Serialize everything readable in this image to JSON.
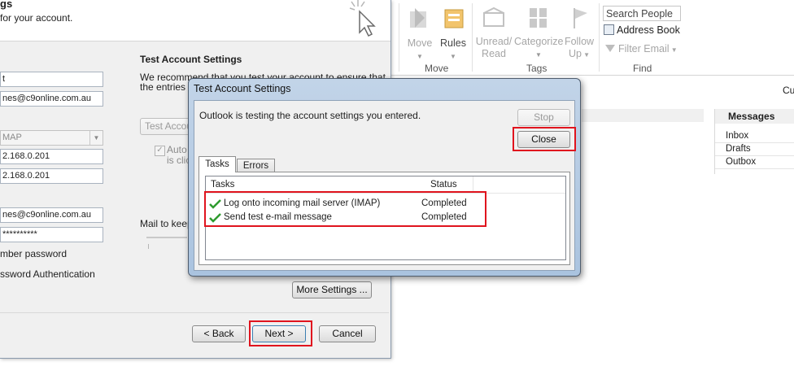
{
  "account_dialog": {
    "header_title": "gs",
    "header_subtitle": "for your account.",
    "test_section_heading": "Test Account Settings",
    "test_section_text_line1": "We recommend that you test your account to ensure that",
    "test_section_text_line2": "the entries a",
    "test_button_label": "Test Accou",
    "auto_check_line1": "Auto",
    "auto_check_line2": "is clic",
    "mail_to_keep_label": "Mail to keep",
    "fields": {
      "name": "t",
      "email": "nes@c9online.com.au",
      "account_type": "MAP",
      "incoming_server": "2.168.0.201",
      "outgoing_server": "2.168.0.201",
      "user_name": "nes@c9online.com.au",
      "password": "**********"
    },
    "remember_password_label": "mber password",
    "spa_label": "ssword Authentication",
    "more_settings_label": "More Settings ...",
    "back_label": "< Back",
    "next_label": "Next >",
    "cancel_label": "Cancel"
  },
  "test_dialog": {
    "title": "Test Account Settings",
    "message": "Outlook is testing the account settings you entered.",
    "stop_label": "Stop",
    "close_label": "Close",
    "tabs": [
      "Tasks",
      "Errors"
    ],
    "columns": {
      "task": "Tasks",
      "status": "Status"
    },
    "rows": [
      {
        "task": "Log onto incoming mail server (IMAP)",
        "status": "Completed"
      },
      {
        "task": "Send test e-mail message",
        "status": "Completed"
      }
    ]
  },
  "ribbon": {
    "move": {
      "label": "Move",
      "group": "Move"
    },
    "rules": {
      "label": "Rules"
    },
    "unread_read": {
      "line1": "Unread/",
      "line2": "Read"
    },
    "categorize": {
      "label": "Categorize"
    },
    "follow_up": {
      "line1": "Follow",
      "line2": "Up"
    },
    "tags_group": "Tags",
    "search_people_placeholder": "Search People",
    "address_book": "Address Book",
    "filter_email": "Filter Email",
    "find_group": "Find"
  },
  "right_pane": {
    "cus_label": "Cus",
    "messages_heading": "Messages",
    "folders": [
      "Inbox",
      "Drafts",
      "Outbox"
    ]
  },
  "colors": {
    "highlight_red": "#e0141e",
    "check_green": "#2f9b2f",
    "dialog_frame": "#aac3df"
  }
}
